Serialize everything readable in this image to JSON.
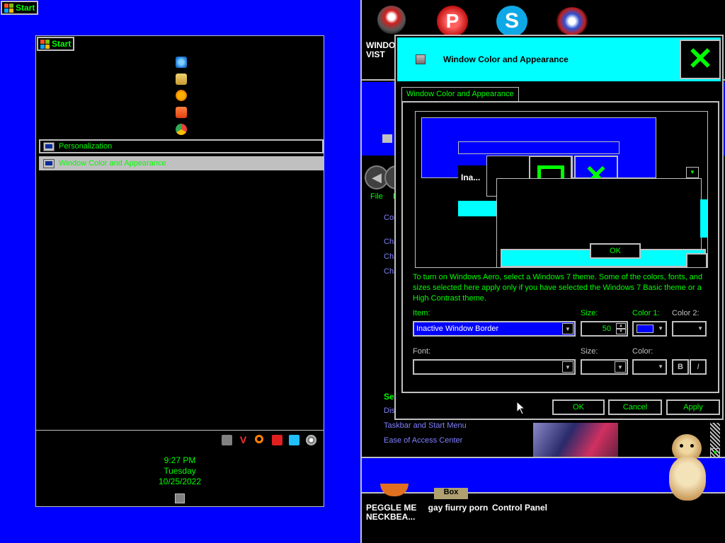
{
  "taskbar": {
    "start_label": "Start"
  },
  "start_menu": {
    "start_label": "Start",
    "results": [
      {
        "label": "Personalization"
      },
      {
        "label": "Window Color and Appearance"
      }
    ],
    "clock": {
      "time": "9:27 PM",
      "day": "Tuesday",
      "date": "10/25/2022"
    }
  },
  "desktop": {
    "icon_label_1": "WINDO\nVIST",
    "bottom_labels": [
      "PEGGLE ME NECKBEA...",
      "gay fiurry porn",
      "Control Panel"
    ],
    "box_label": "Box"
  },
  "control_panel": {
    "menu": [
      "File",
      "E"
    ],
    "side_links": [
      "Con",
      "Cha",
      "Cha",
      "Cha"
    ],
    "see_also": "Se",
    "disp": "Disp",
    "links": [
      "Taskbar and Start Menu",
      "Ease of Access Center"
    ]
  },
  "dialog": {
    "title": "Window Color and Appearance",
    "tab": "Window Color and Appearance",
    "preview": {
      "inactive_label": "Ina...",
      "ok_label": "OK"
    },
    "info": "To turn on Windows Aero, select a Windows 7 theme.  Some of the colors, fonts, and sizes selected here apply only if you have selected the Windows 7 Basic theme or a High Contrast theme.",
    "item_label": "Item:",
    "item_value": "Inactive Window Border",
    "size_label": "Size:",
    "size_value": "50",
    "color1_label": "Color 1:",
    "color1_value": "#0000ff",
    "color2_label": "Color 2:",
    "font_label": "Font:",
    "font_size_label": "Size:",
    "font_color_label": "Color:",
    "bold_label": "B",
    "italic_label": "I",
    "ok": "OK",
    "cancel": "Cancel",
    "apply": "Apply"
  }
}
